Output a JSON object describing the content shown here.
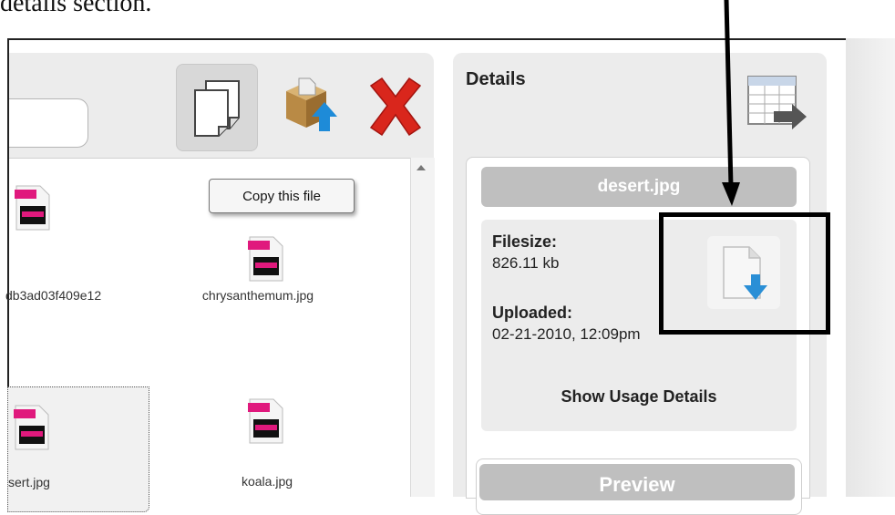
{
  "caption": "details section.",
  "toolbar": {
    "copy_icon": "copy-file-icon",
    "upload_icon": "upload-box-icon",
    "delete_icon": "red-x-icon"
  },
  "tooltip": "Copy this file",
  "files": [
    {
      "name": "db3ad03f409e12",
      "icon": "jpg-file-icon"
    },
    {
      "name": "chrysanthemum.jpg",
      "icon": "jpg-file-icon"
    },
    {
      "name": "sert.jpg",
      "icon": "jpg-file-icon",
      "selected": true
    },
    {
      "name": "koala.jpg",
      "icon": "jpg-file-icon"
    }
  ],
  "details": {
    "title": "Details",
    "export_icon": "export-table-icon",
    "file_name": "desert.jpg",
    "filesize_label": "Filesize:",
    "filesize_value": "826.11 kb",
    "uploaded_label": "Uploaded:",
    "uploaded_value": "02-21-2010, 12:09pm",
    "usage_link": "Show Usage Details",
    "download_icon": "download-file-icon",
    "preview_label": "Preview"
  },
  "colors": {
    "panel_bg": "#ececec",
    "title_bar": "#bfbfbf",
    "delete_red": "#d9261c",
    "download_blue": "#2a8fd6",
    "jpg_pink": "#e0197d"
  }
}
